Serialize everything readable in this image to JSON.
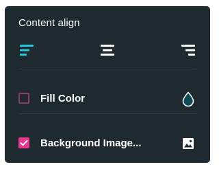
{
  "panel": {
    "title": "Content align"
  },
  "align": {
    "options": [
      {
        "label": "left",
        "icon": "align-left-icon",
        "active": true
      },
      {
        "label": "center",
        "icon": "align-center-icon",
        "active": false
      },
      {
        "label": "right",
        "icon": "align-right-icon",
        "active": false
      }
    ]
  },
  "fill": {
    "label": "Fill Color",
    "checked": false,
    "icon": "drop-icon"
  },
  "background": {
    "label": "Background Image...",
    "checked": true,
    "icon": "image-icon"
  },
  "colors": {
    "panel_bg": "#1f2a30",
    "accent_cyan": "#26c6da",
    "accent_pink": "#e8368f",
    "text": "#ffffff"
  }
}
